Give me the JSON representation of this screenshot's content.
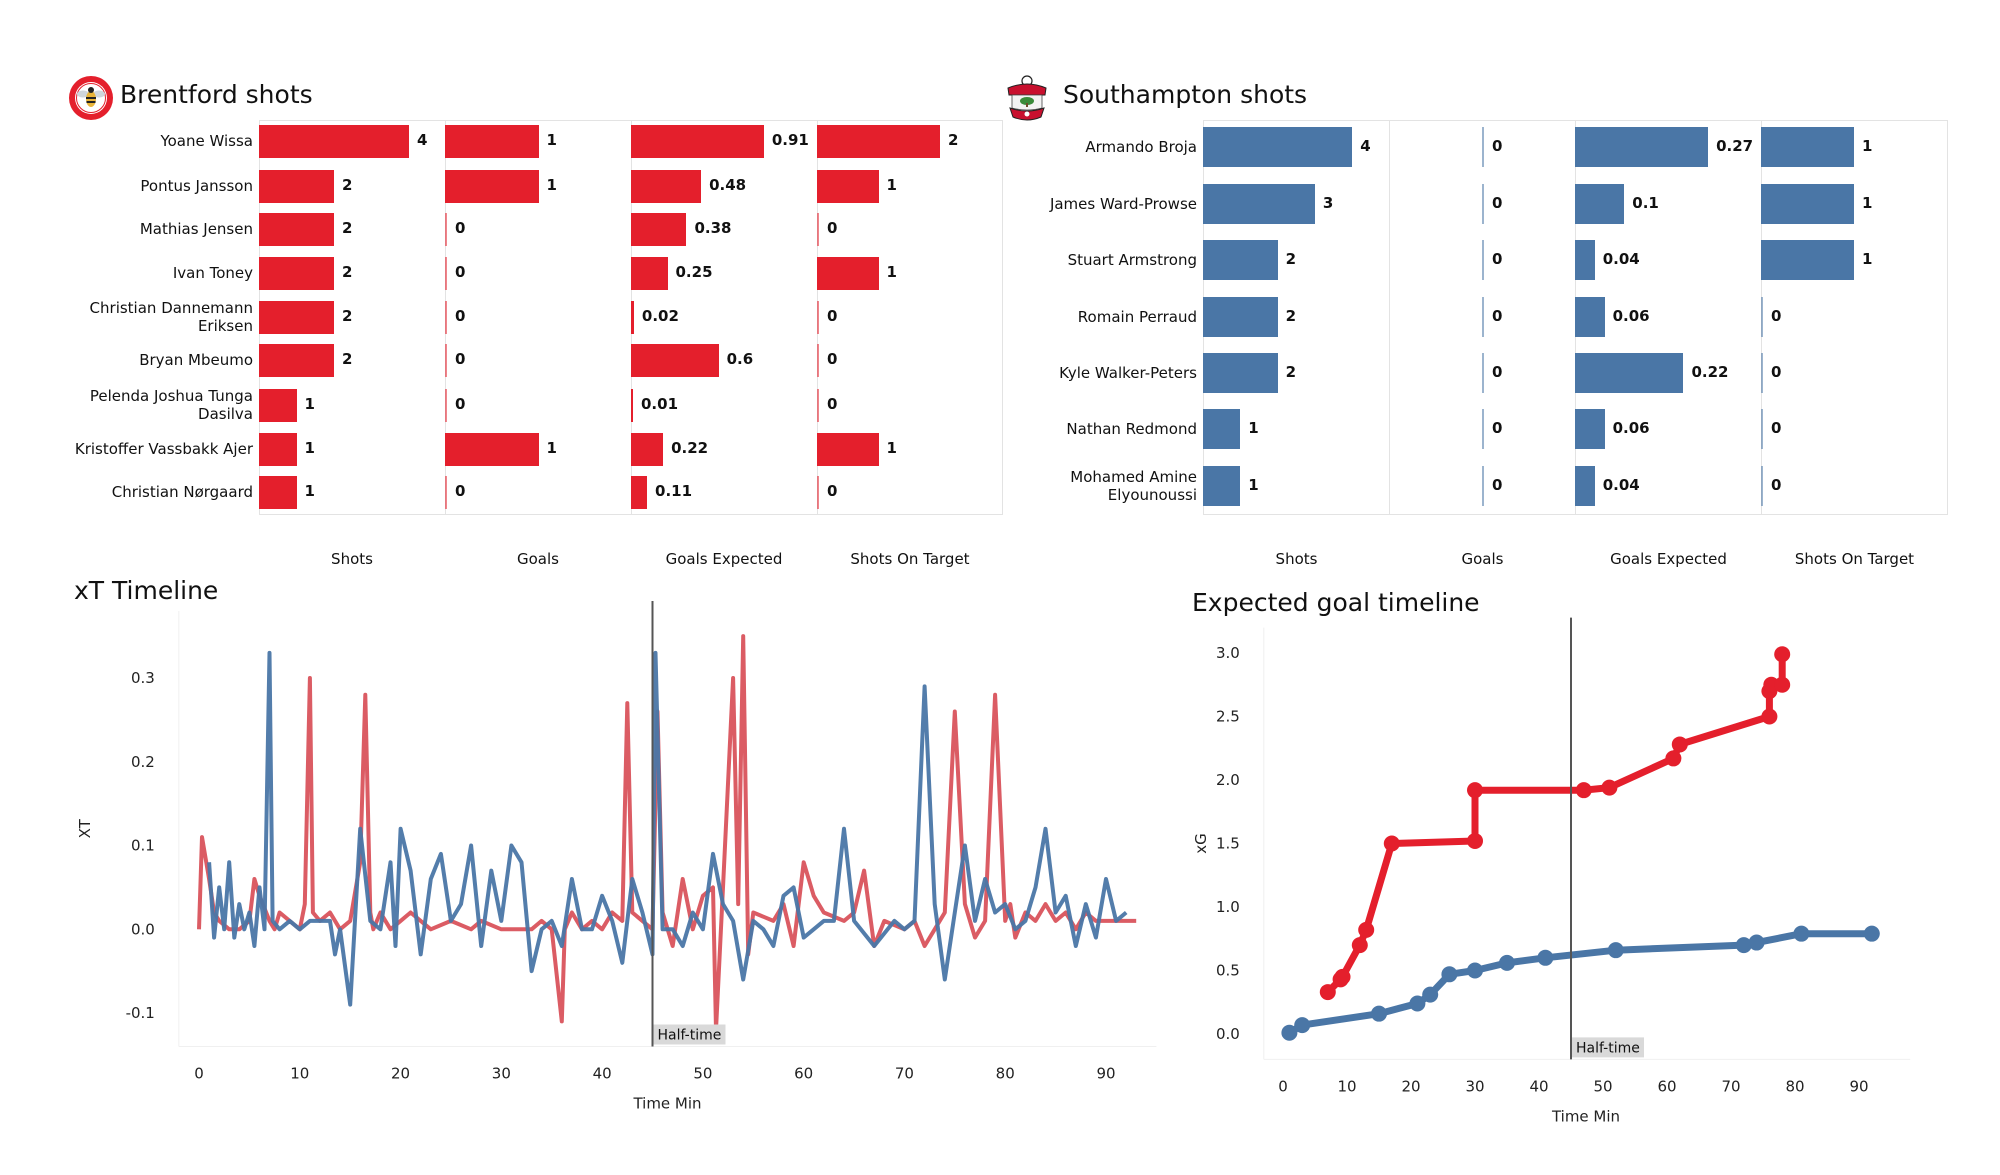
{
  "colors": {
    "brentford": "#e41f2c",
    "southampton": "#4a76a6",
    "brentford_line": "#d9535c",
    "southampton_line": "#4a76a6",
    "halftime_line": "#555555",
    "halftime_label_bg": "#d9d9d9"
  },
  "brentford": {
    "title": "Brentford shots",
    "logo_icon": "brentford-bee-crest-icon",
    "columns": [
      "Shots",
      "Goals",
      "Goals Expected",
      "Shots On Target"
    ],
    "players": [
      {
        "name": "Yoane Wissa",
        "shots": 4,
        "goals": 1,
        "xg": 0.91,
        "sot": 2
      },
      {
        "name": "Pontus Jansson",
        "shots": 2,
        "goals": 1,
        "xg": 0.48,
        "sot": 1
      },
      {
        "name": "Mathias Jensen",
        "shots": 2,
        "goals": 0,
        "xg": 0.38,
        "sot": 0
      },
      {
        "name": "Ivan Toney",
        "shots": 2,
        "goals": 0,
        "xg": 0.25,
        "sot": 1
      },
      {
        "name": "Christian  Dannemann\nEriksen",
        "shots": 2,
        "goals": 0,
        "xg": 0.02,
        "sot": 0
      },
      {
        "name": "Bryan Mbeumo",
        "shots": 2,
        "goals": 0,
        "xg": 0.6,
        "sot": 0
      },
      {
        "name": "Pelenda Joshua Tunga\nDasilva",
        "shots": 1,
        "goals": 0,
        "xg": 0.01,
        "sot": 0
      },
      {
        "name": "Kristoffer Vassbakk Ajer",
        "shots": 1,
        "goals": 1,
        "xg": 0.22,
        "sot": 1
      },
      {
        "name": "Christian Nørgaard",
        "shots": 1,
        "goals": 0,
        "xg": 0.11,
        "sot": 0
      }
    ]
  },
  "southampton": {
    "title": "Southampton shots",
    "logo_icon": "southampton-crest-icon",
    "columns": [
      "Shots",
      "Goals",
      "Goals Expected",
      "Shots On Target"
    ],
    "players": [
      {
        "name": "Armando Broja",
        "shots": 4,
        "goals": 0,
        "xg": 0.27,
        "sot": 1
      },
      {
        "name": "James  Ward-Prowse",
        "shots": 3,
        "goals": 0,
        "xg": 0.1,
        "sot": 1
      },
      {
        "name": "Stuart Armstrong",
        "shots": 2,
        "goals": 0,
        "xg": 0.04,
        "sot": 1
      },
      {
        "name": "Romain Perraud",
        "shots": 2,
        "goals": 0,
        "xg": 0.06,
        "sot": 0
      },
      {
        "name": "Kyle Walker-Peters",
        "shots": 2,
        "goals": 0,
        "xg": 0.22,
        "sot": 0
      },
      {
        "name": "Nathan Redmond",
        "shots": 1,
        "goals": 0,
        "xg": 0.06,
        "sot": 0
      },
      {
        "name": "Mohamed Amine\nElyounoussi",
        "shots": 1,
        "goals": 0,
        "xg": 0.04,
        "sot": 0
      }
    ]
  },
  "chart_data": [
    {
      "type": "bar",
      "title": "Brentford shots",
      "orientation": "horizontal",
      "categories": [
        "Yoane Wissa",
        "Pontus Jansson",
        "Mathias Jensen",
        "Ivan Toney",
        "Christian Dannemann Eriksen",
        "Bryan Mbeumo",
        "Pelenda Joshua Tunga Dasilva",
        "Kristoffer Vassbakk Ajer",
        "Christian Nørgaard"
      ],
      "series": [
        {
          "name": "Shots",
          "values": [
            4,
            2,
            2,
            2,
            2,
            2,
            1,
            1,
            1
          ]
        },
        {
          "name": "Goals",
          "values": [
            1,
            1,
            0,
            0,
            0,
            0,
            0,
            1,
            0
          ]
        },
        {
          "name": "Goals Expected",
          "values": [
            0.91,
            0.48,
            0.38,
            0.25,
            0.02,
            0.6,
            0.01,
            0.22,
            0.11
          ]
        },
        {
          "name": "Shots On Target",
          "values": [
            2,
            1,
            0,
            1,
            0,
            0,
            0,
            1,
            0
          ]
        }
      ]
    },
    {
      "type": "bar",
      "title": "Southampton shots",
      "orientation": "horizontal",
      "categories": [
        "Armando Broja",
        "James Ward-Prowse",
        "Stuart Armstrong",
        "Romain Perraud",
        "Kyle Walker-Peters",
        "Nathan Redmond",
        "Mohamed Amine Elyounoussi"
      ],
      "series": [
        {
          "name": "Shots",
          "values": [
            4,
            3,
            2,
            2,
            2,
            1,
            1
          ]
        },
        {
          "name": "Goals",
          "values": [
            0,
            0,
            0,
            0,
            0,
            0,
            0
          ]
        },
        {
          "name": "Goals Expected",
          "values": [
            0.27,
            0.1,
            0.04,
            0.06,
            0.22,
            0.06,
            0.04
          ]
        },
        {
          "name": "Shots On Target",
          "values": [
            1,
            1,
            1,
            0,
            0,
            0,
            0
          ]
        }
      ]
    },
    {
      "type": "line",
      "title": "xT Timeline",
      "xlabel": "Time Min",
      "ylabel": "XT",
      "xlim": [
        -2,
        95
      ],
      "ylim": [
        -0.14,
        0.38
      ],
      "xticks": [
        0,
        10,
        20,
        30,
        40,
        50,
        60,
        70,
        80,
        90
      ],
      "yticks": [
        -0.1,
        0.0,
        0.1,
        0.2,
        0.3
      ],
      "ytick_labels": [
        "-0.1",
        "0.0",
        "0.1",
        "0.2",
        "0.3"
      ],
      "grid": false,
      "annotation": {
        "x": 45,
        "label": "Half-time"
      },
      "series": [
        {
          "name": "Brentford",
          "color": "#d9535c",
          "x": [
            0,
            0.3,
            1,
            1.5,
            2,
            3,
            4,
            5,
            5.5,
            6,
            7,
            7.5,
            8,
            9,
            10,
            10.5,
            11,
            11.3,
            12,
            13,
            14,
            15,
            16,
            16.5,
            17,
            17.3,
            18,
            19,
            20,
            21,
            22,
            23,
            25,
            27,
            28,
            30,
            32,
            33,
            34,
            35,
            36,
            36.3,
            37,
            38,
            39,
            40,
            41,
            42,
            42.5,
            43,
            44,
            45,
            45.5,
            46,
            47,
            48,
            49,
            50,
            51,
            51.3,
            52,
            53,
            53.5,
            54,
            54.5,
            55,
            57,
            58,
            59,
            60,
            61,
            62,
            64,
            65,
            66,
            67,
            68,
            70,
            71,
            72,
            73,
            74,
            75,
            76,
            77,
            78,
            79,
            80,
            80.5,
            81,
            82,
            83,
            84,
            85,
            86,
            87,
            88,
            89,
            90,
            91,
            93
          ],
          "y": [
            0,
            0.11,
            0.06,
            0.02,
            0.01,
            0,
            0,
            0.01,
            0.06,
            0.04,
            0.01,
            0,
            0.02,
            0.01,
            0,
            0.03,
            0.3,
            0.02,
            0.01,
            0.02,
            0,
            0.01,
            0.08,
            0.28,
            0.02,
            0,
            0.02,
            0,
            0.01,
            0.02,
            0.01,
            0,
            0.01,
            0,
            0.01,
            0,
            0,
            0,
            0.01,
            0,
            -0.11,
            0,
            0.02,
            0,
            0.01,
            0,
            0.02,
            0.01,
            0.27,
            0.02,
            0.01,
            0,
            0.26,
            0.02,
            -0.02,
            0.06,
            0,
            0.04,
            0.05,
            -0.12,
            0.05,
            0.3,
            0.03,
            0.35,
            -0.03,
            0.02,
            0.01,
            0.03,
            -0.02,
            0.08,
            0.04,
            0.02,
            0.01,
            0.02,
            0.07,
            -0.02,
            0.01,
            0,
            0.01,
            -0.02,
            0,
            0.02,
            0.26,
            0.03,
            -0.01,
            0.01,
            0.28,
            0.01,
            0.03,
            -0.01,
            0.02,
            0.01,
            0.03,
            0.01,
            0.02,
            0,
            0.02,
            0.01,
            0.01,
            0.01,
            0.01,
            0.01,
            0
          ]
        },
        {
          "name": "Southampton",
          "color": "#4a76a6",
          "x": [
            1,
            1.5,
            2,
            2.5,
            3,
            3.5,
            4,
            4.5,
            5,
            5.5,
            6,
            6.5,
            7,
            7.3,
            8,
            9,
            10,
            11,
            12,
            13,
            13.5,
            14,
            15,
            16,
            17,
            18,
            19,
            19.5,
            20,
            21,
            22,
            23,
            24,
            25,
            26,
            27,
            28,
            29,
            30,
            31,
            32,
            33,
            34,
            35,
            36,
            37,
            38,
            39,
            40,
            41,
            42,
            43,
            44,
            45,
            45.3,
            46,
            47,
            48,
            49,
            50,
            51,
            52,
            53,
            54,
            55,
            56,
            57,
            58,
            59,
            60,
            61,
            62,
            63,
            64,
            65,
            67,
            69,
            70,
            71,
            72,
            73,
            74,
            75,
            76,
            77,
            78,
            79,
            80,
            81,
            82,
            83,
            84,
            85,
            86,
            87,
            88,
            89,
            90,
            91,
            92
          ],
          "y": [
            0.08,
            -0.01,
            0.05,
            0,
            0.08,
            -0.01,
            0.03,
            0,
            0.02,
            -0.02,
            0.05,
            0,
            0.33,
            0.01,
            0,
            0.01,
            0,
            0.01,
            0.01,
            0.01,
            -0.03,
            0,
            -0.09,
            0.12,
            0.01,
            0,
            0.08,
            -0.02,
            0.12,
            0.07,
            -0.03,
            0.06,
            0.09,
            0.01,
            0.03,
            0.1,
            -0.02,
            0.07,
            0.01,
            0.1,
            0.08,
            -0.05,
            0,
            0.01,
            -0.02,
            0.06,
            0,
            0,
            0.04,
            0.01,
            -0.04,
            0.06,
            0.02,
            -0.03,
            0.33,
            0,
            0,
            -0.02,
            0.02,
            0,
            0.09,
            0.03,
            0.01,
            -0.06,
            0.01,
            0,
            -0.02,
            0.04,
            0.05,
            -0.01,
            0.0,
            0.01,
            0.01,
            0.12,
            0.01,
            -0.02,
            0.01,
            0.0,
            0.01,
            0.29,
            0.03,
            -0.06,
            0.02,
            0.1,
            0.01,
            0.06,
            0.02,
            0.03,
            0.0,
            0.01,
            0.05,
            0.12,
            0.02,
            0.04,
            -0.02,
            0.03,
            -0.01,
            0.06,
            0.01,
            0.02,
            0.01,
            0.06,
            0.01
          ]
        }
      ]
    },
    {
      "type": "line",
      "title": "Expected goal timeline",
      "xlabel": "Time Min",
      "ylabel": "xG",
      "xlim": [
        -3,
        98
      ],
      "ylim": [
        -0.2,
        3.2
      ],
      "xticks": [
        0,
        10,
        20,
        30,
        40,
        50,
        60,
        70,
        80,
        90
      ],
      "yticks": [
        0.0,
        0.5,
        1.0,
        1.5,
        2.0,
        2.5,
        3.0
      ],
      "ytick_labels": [
        "0.0",
        "0.5",
        "1.0",
        "1.5",
        "2.0",
        "2.5",
        "3.0"
      ],
      "grid": false,
      "markers": true,
      "annotation": {
        "x": 45,
        "label": "Half-time"
      },
      "series": [
        {
          "name": "Brentford",
          "color": "#e41f2c",
          "x": [
            7,
            9,
            9.3,
            12,
            13,
            17,
            30,
            30,
            47,
            51,
            61,
            62,
            76,
            76,
            76.3,
            78,
            78
          ],
          "y": [
            0.33,
            0.43,
            0.45,
            0.7,
            0.82,
            1.5,
            1.52,
            1.92,
            1.92,
            1.94,
            2.17,
            2.28,
            2.5,
            2.7,
            2.75,
            2.75,
            2.99
          ]
        },
        {
          "name": "Southampton",
          "color": "#4a76a6",
          "x": [
            1,
            3,
            15,
            21,
            23,
            26,
            30,
            35,
            41,
            52,
            72,
            74,
            81,
            92
          ],
          "y": [
            0.01,
            0.07,
            0.16,
            0.24,
            0.31,
            0.47,
            0.5,
            0.56,
            0.6,
            0.66,
            0.7,
            0.72,
            0.79,
            0.79
          ]
        }
      ]
    }
  ]
}
